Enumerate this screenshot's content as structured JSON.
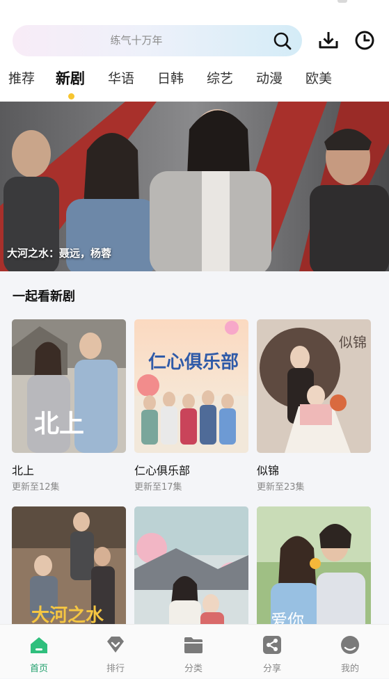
{
  "search": {
    "placeholder": "练气十万年"
  },
  "header_icons": [
    "download-icon",
    "history-icon"
  ],
  "tabs": [
    {
      "label": "推荐",
      "active": false
    },
    {
      "label": "新剧",
      "active": true
    },
    {
      "label": "华语",
      "active": false
    },
    {
      "label": "日韩",
      "active": false
    },
    {
      "label": "综艺",
      "active": false
    },
    {
      "label": "动漫",
      "active": false
    },
    {
      "label": "欧美",
      "active": false
    }
  ],
  "banner": {
    "caption": "大河之水：聂远，杨蓉"
  },
  "section": {
    "title": "一起看新剧",
    "items": [
      {
        "title": "北上",
        "update": "更新至12集",
        "poster_text": "北上"
      },
      {
        "title": "仁心俱乐部",
        "update": "更新至17集",
        "poster_text": "仁心俱乐部"
      },
      {
        "title": "似锦",
        "update": "更新至23集",
        "poster_text": "似锦"
      },
      {
        "poster_text": "大河之水"
      },
      {
        "poster_text": ""
      },
      {
        "poster_text": "爱你"
      }
    ]
  },
  "tabbar": [
    {
      "label": "首页",
      "icon": "home-icon",
      "active": true
    },
    {
      "label": "排行",
      "icon": "ranking-icon",
      "active": false
    },
    {
      "label": "分类",
      "icon": "folder-icon",
      "active": false
    },
    {
      "label": "分享",
      "icon": "share-icon",
      "active": false
    },
    {
      "label": "我的",
      "icon": "profile-icon",
      "active": false
    }
  ],
  "colors": {
    "accent_green": "#1f9f6b",
    "tab_indicator": "#f7c530"
  }
}
